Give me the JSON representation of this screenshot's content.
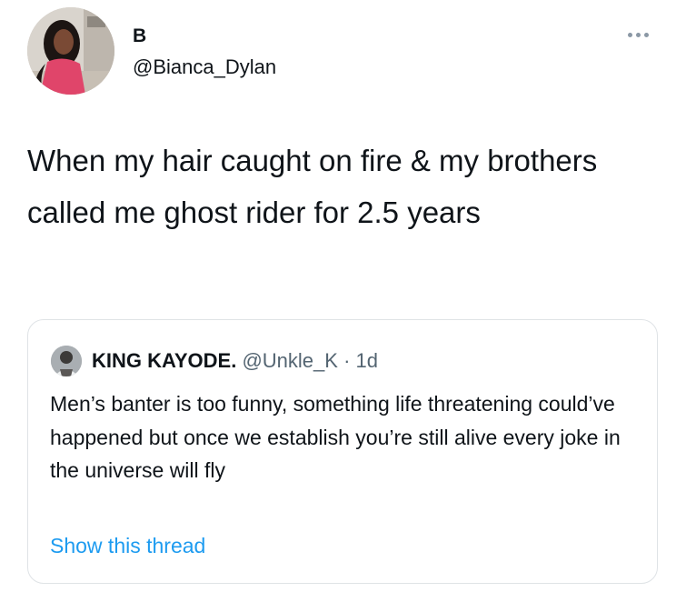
{
  "author": {
    "display_name": "B",
    "handle": "@Bianca_Dylan",
    "avatar_icon": "profile-photo"
  },
  "tweet": {
    "text": "When my hair caught on fire & my brothers called me ghost rider for 2.5 years"
  },
  "more_icon": "ellipsis-icon",
  "quoted_tweet": {
    "display_name": "KING KAYODE.",
    "handle": "@Unkle_K",
    "separator": "·",
    "time": "1d",
    "text": "Men’s banter is too funny, something life threatening could’ve happened but once we establish you’re still alive every joke in the universe will fly",
    "show_thread_label": "Show this thread"
  },
  "colors": {
    "text_primary": "#0f1419",
    "text_secondary": "#536471",
    "link": "#1d9bf0",
    "border": "#dfe3e6"
  }
}
